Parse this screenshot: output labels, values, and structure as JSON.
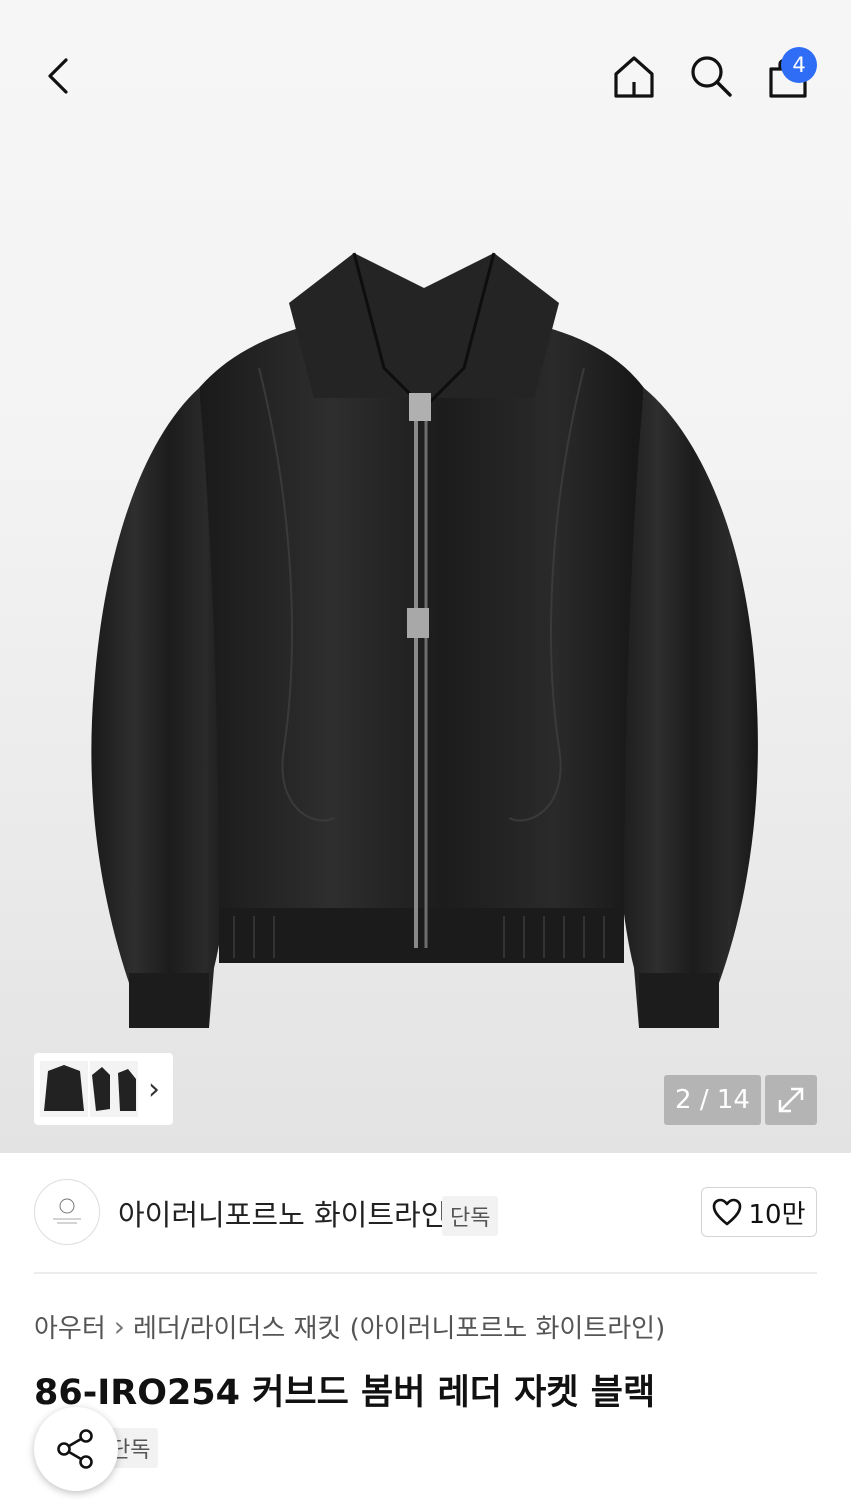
{
  "header": {
    "back_icon": "chevron-left-icon",
    "home_icon": "home-icon",
    "search_icon": "search-icon",
    "cart_icon": "shopping-bag-icon",
    "cart_count": "4",
    "badge_color": "#2f6df6"
  },
  "gallery": {
    "counter": "2 / 14",
    "expand_icon": "expand-icon",
    "thumbs_arrow": "›"
  },
  "store": {
    "name": "아이러니포르노 화이트라인",
    "tag": "단독",
    "like_count": "10만",
    "like_icon": "heart-icon"
  },
  "product": {
    "breadcrumb_root": "아우터",
    "breadcrumb_sep": "›",
    "breadcrumb_leaf": "레더/라이더스 재킷 (아이러니포르노 화이트라인)",
    "title": "86-IRO254 커브드 봄버 레더 자켓 블랙",
    "tag": "단독"
  },
  "share_icon": "share-icon"
}
